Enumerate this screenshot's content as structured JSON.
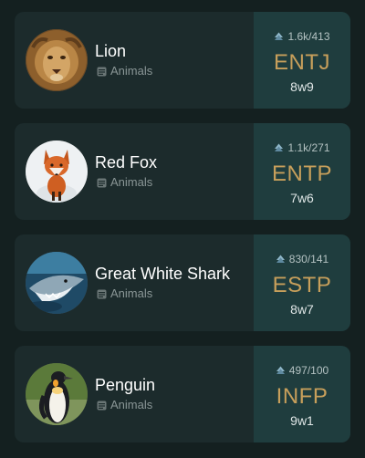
{
  "profiles": [
    {
      "name": "Lion",
      "category": "Animals",
      "votes": "1.6k/413",
      "type": "ENTJ",
      "wing": "8w9",
      "avatar_image": "lion-face-photo",
      "votes_icon": "vote-icon",
      "category_icon": "category-icon"
    },
    {
      "name": "Red Fox",
      "category": "Animals",
      "votes": "1.1k/271",
      "type": "ENTP",
      "wing": "7w6",
      "avatar_image": "red-fox-in-snow-photo",
      "votes_icon": "vote-icon",
      "category_icon": "category-icon"
    },
    {
      "name": "Great White Shark",
      "category": "Animals",
      "votes": "830/141",
      "type": "ESTP",
      "wing": "8w7",
      "avatar_image": "great-white-shark-photo",
      "votes_icon": "vote-icon",
      "category_icon": "category-icon"
    },
    {
      "name": "Penguin",
      "category": "Animals",
      "votes": "497/100",
      "type": "INFP",
      "wing": "9w1",
      "avatar_image": "king-penguin-photo",
      "votes_icon": "vote-icon",
      "category_icon": "category-icon"
    }
  ],
  "colors": {
    "background": "#142020",
    "card": "#1c2b2c",
    "card_accent": "#1f3d3e",
    "type_text": "#c79f5b",
    "muted_text": "#8a9696"
  }
}
